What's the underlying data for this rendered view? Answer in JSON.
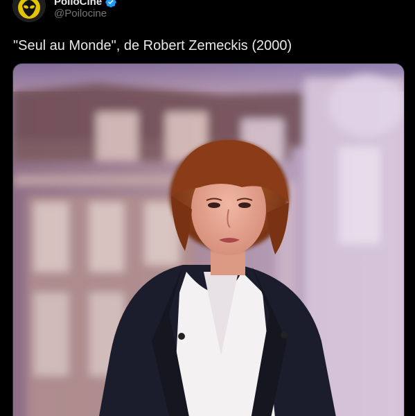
{
  "author": {
    "display_name": "PoiloCine",
    "handle": "@Poilocine",
    "verified": true,
    "avatar_icon": "alien-icon",
    "avatar_colors": {
      "badge": "#e5c400",
      "alien": "#111111"
    }
  },
  "tweet": {
    "text": "\"Seul au Monde\", de Robert Zemeckis (2000)"
  },
  "media": {
    "type": "photo",
    "icon": "photo"
  },
  "icons": {
    "verified": "verified-badge-icon",
    "more": "more-icon"
  },
  "colors": {
    "background": "#000000",
    "text_primary": "#e7e9ea",
    "text_secondary": "#71767b",
    "verified_blue": "#1d9bf0"
  }
}
